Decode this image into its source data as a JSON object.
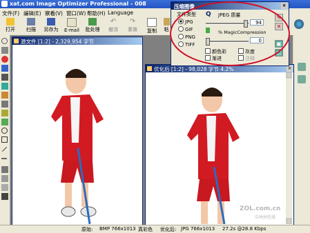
{
  "window": {
    "title": "xat.com   Image Optimizer Professional - 008"
  },
  "menu": [
    "文件(F)",
    "编辑(E)",
    "察看(V)",
    "窗口(W)",
    "帮助(H)",
    "Language"
  ],
  "toolbar": {
    "open": "打开",
    "scan": "扫描",
    "save_as": "另存为",
    "email": "E-mail",
    "batch": "批处理",
    "undo": "撤消",
    "redo": "重做",
    "copy": "复制",
    "paste": "粘"
  },
  "source_window": {
    "title": "源文件 [1:2] - 2,329,954 字节"
  },
  "optimized_window": {
    "title": "优化后 [1:2] - 98,028 字节  4.2%"
  },
  "dialog": {
    "title": "压缩图像",
    "format_label": "文件类型",
    "formats": [
      "JPG",
      "GIF",
      "PNG",
      "TIFF"
    ],
    "selected_format": "JPG",
    "quality_label": "JPEG 质量",
    "quality_value": "94",
    "magic_label": "% MagicCompression",
    "magic_value": "0",
    "quality_fraction": 0.94,
    "magic_fraction": 0.0,
    "check_color": "颜色彩",
    "check_progressive": "渐进",
    "check_gray": "灰度",
    "check_comment": "注释"
  },
  "status": {
    "original_label": "原始:",
    "original_info": "BMP 766x1013",
    "original_color": "真彩色",
    "optimized_label": "优化后:",
    "optimized_info": "JPG 766x1013",
    "optimized_speed": "27.2s @28.8 Kbps"
  },
  "watermark": {
    "site": "ZOL.com.cn",
    "sub": "中关村在线"
  },
  "colors": {
    "accent": "#0a246a",
    "highlight": "#d0102a",
    "shirt": "#d21a22"
  }
}
